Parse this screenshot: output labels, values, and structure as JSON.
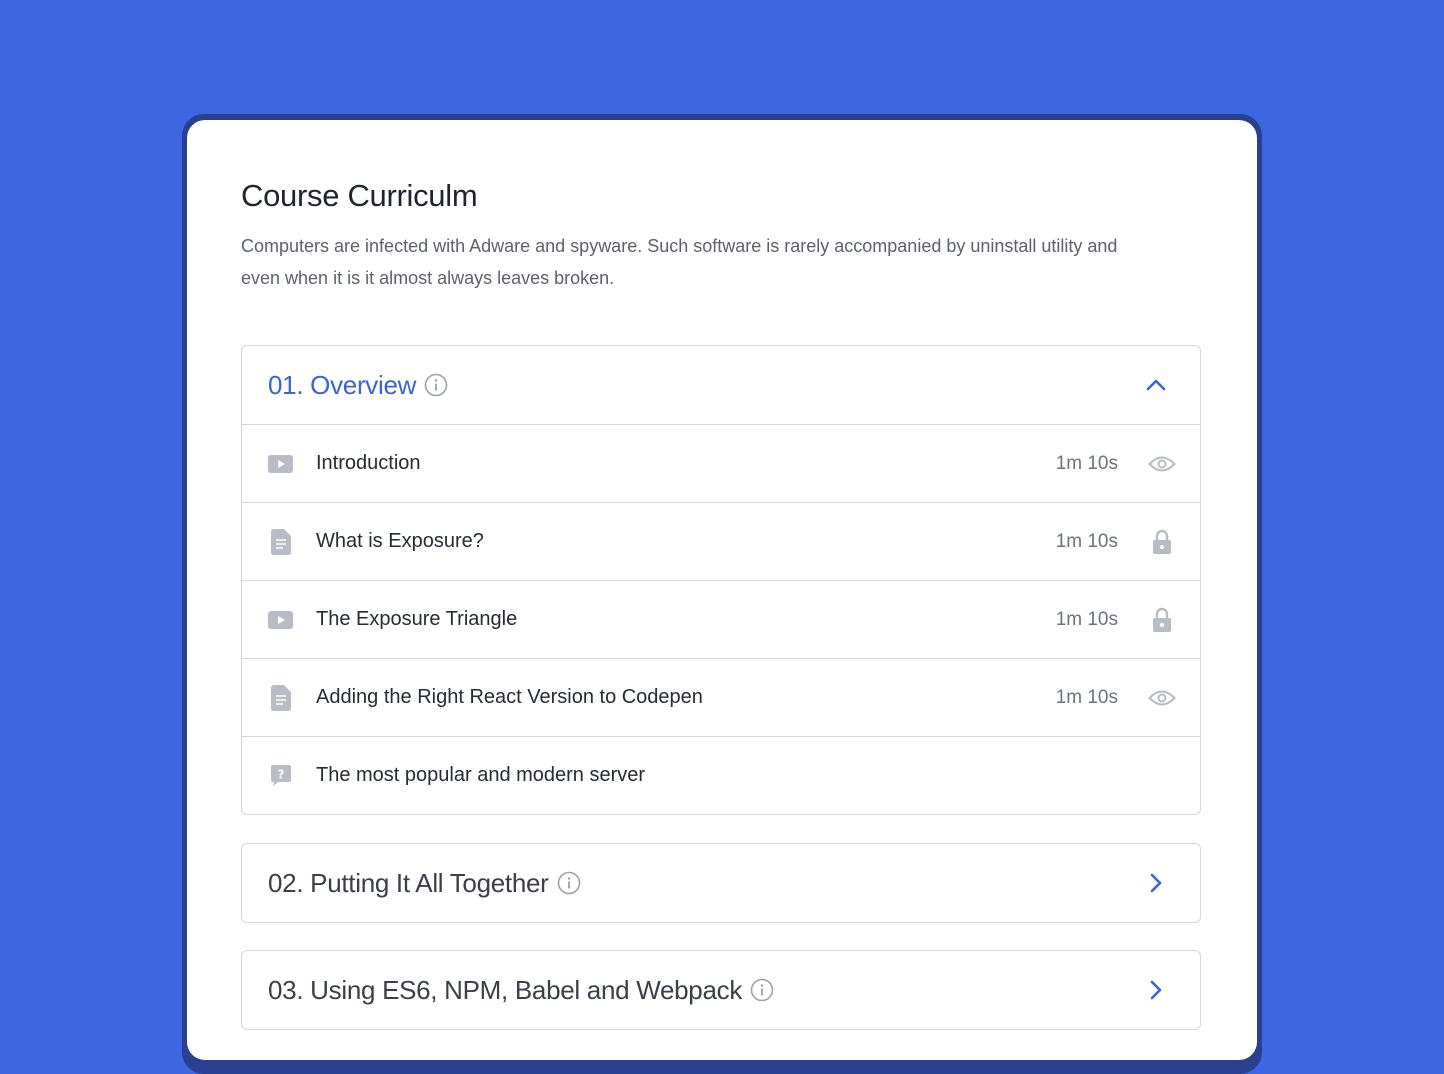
{
  "course": {
    "title": "Course Curriculm",
    "description": "Computers are infected with Adware and spyware. Such software is rarely accompanied by uninstall utility and even when it is it almost always leaves broken."
  },
  "sections": [
    {
      "title": "01. Overview",
      "expanded": true,
      "lessons": [
        {
          "type": "video-icon",
          "title": "Introduction",
          "duration": "1m 10s",
          "status": "eye-icon"
        },
        {
          "type": "document-icon",
          "title": "What is Exposure?",
          "duration": "1m 10s",
          "status": "lock-icon"
        },
        {
          "type": "video-icon",
          "title": "The Exposure Triangle",
          "duration": "1m 10s",
          "status": "lock-icon"
        },
        {
          "type": "document-icon",
          "title": "Adding the Right React Version to Codepen",
          "duration": "1m 10s",
          "status": "eye-icon"
        },
        {
          "type": "quiz-icon",
          "title": "The most popular and modern server"
        }
      ]
    },
    {
      "title": "02. Putting It All Together",
      "expanded": false
    },
    {
      "title": "03. Using ES6, NPM, Babel and Webpack",
      "expanded": false
    }
  ],
  "colors": {
    "background": "#3d66e0",
    "accent": "#3b63d6",
    "icon_gray": "#b8bcc6",
    "border": "#d4d8df"
  }
}
